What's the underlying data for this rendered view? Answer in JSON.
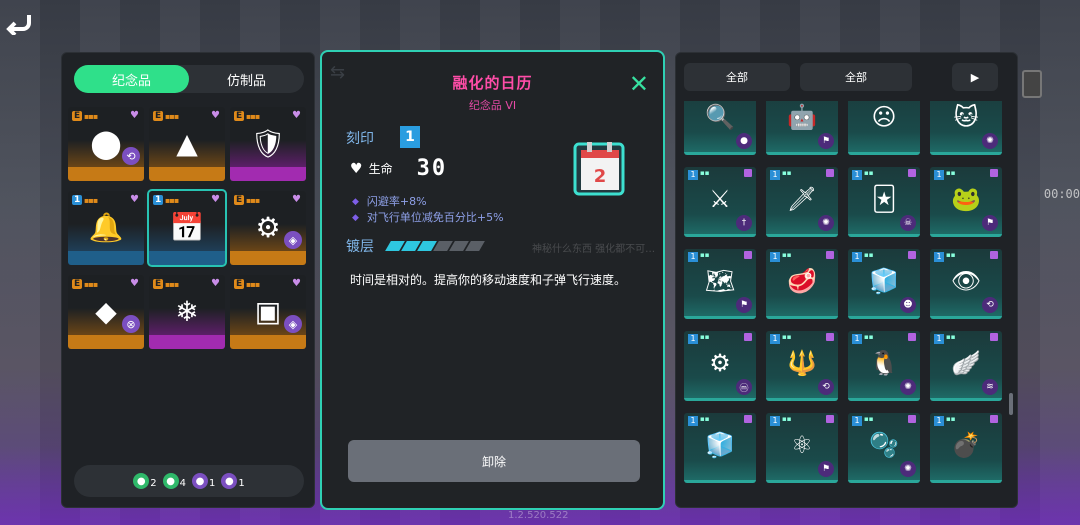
{
  "left_panel": {
    "tabs": [
      {
        "label": "纪念品",
        "active": true
      },
      {
        "label": "仿制品",
        "active": false
      }
    ],
    "items": [
      {
        "rank": "E",
        "rarity": "orange",
        "icon": "orb-cluster-icon",
        "glyph": "⬤",
        "corner": "⟲",
        "corner_color": "#7b4fc0"
      },
      {
        "rank": "E",
        "rarity": "orange",
        "icon": "triangle-icon",
        "glyph": "▲",
        "corner": "",
        "corner_color": ""
      },
      {
        "rank": "E",
        "rarity": "purple",
        "icon": "shield-icon",
        "glyph": "🛡",
        "corner": "",
        "corner_color": ""
      },
      {
        "rank": "1",
        "rarity": "blue",
        "icon": "bell-icon",
        "glyph": "🔔",
        "corner": "",
        "corner_color": ""
      },
      {
        "rank": "1",
        "rarity": "selected",
        "icon": "calendar-icon",
        "glyph": "📅",
        "corner": "",
        "corner_color": ""
      },
      {
        "rank": "E",
        "rarity": "orange",
        "icon": "gun-icon",
        "glyph": "⚙",
        "corner": "◈",
        "corner_color": "#7b4fc0"
      },
      {
        "rank": "E",
        "rarity": "orange",
        "icon": "crystal-icon",
        "glyph": "◆",
        "corner": "⊗",
        "corner_color": "#7b4fc0"
      },
      {
        "rank": "E",
        "rarity": "purple",
        "icon": "ice-icon",
        "glyph": "❄",
        "corner": "",
        "corner_color": ""
      },
      {
        "rank": "E",
        "rarity": "orange",
        "icon": "chip-icon",
        "glyph": "▣",
        "corner": "◈",
        "corner_color": "#7b4fc0"
      }
    ],
    "stats": [
      {
        "icon": "green-face-icon",
        "color": "#2fb86a",
        "count": "2"
      },
      {
        "icon": "green-up-icon",
        "color": "#2fb86a",
        "count": "4"
      },
      {
        "icon": "purple-cross-icon",
        "color": "#7b4fc0",
        "count": "1"
      },
      {
        "icon": "purple-eye-icon",
        "color": "#7b4fc0",
        "count": "1"
      }
    ]
  },
  "detail": {
    "title": "融化的日历",
    "subtitle": "纪念品 VI",
    "engrave_label": "刻印",
    "engrave_value": "1",
    "life_label": "生命",
    "life_value": "30",
    "buffs": [
      "闪避率+8%",
      "对飞行单位减免百分比+5%"
    ],
    "plating_label": "镀层",
    "plating_on": 3,
    "plating_total": 6,
    "faded_text": "神秘什么东西 强化都不可…",
    "description": "时间是相对的。提高你的移动速度和子弹飞行速度。",
    "unload_label": "卸除"
  },
  "right_panel": {
    "filters": [
      "全部",
      "全部",
      "▶"
    ],
    "rows": [
      [
        {
          "icon": "magnifier-icon",
          "glyph": "🔍",
          "corner": "●"
        },
        {
          "icon": "robot-icon",
          "glyph": "🤖",
          "corner": "⚑"
        },
        {
          "icon": "sad-face-icon",
          "glyph": "☹",
          "corner": ""
        },
        {
          "icon": "cat-mask-icon",
          "glyph": "🐱",
          "corner": "✺"
        }
      ],
      [
        {
          "icon": "sword-icon",
          "glyph": "⚔",
          "corner": "†"
        },
        {
          "icon": "blade-icon",
          "glyph": "🗡",
          "corner": "✺"
        },
        {
          "icon": "card-icon",
          "glyph": "🃏",
          "corner": "☠"
        },
        {
          "icon": "green-creature-icon",
          "glyph": "🐸",
          "corner": "⚑"
        }
      ],
      [
        {
          "icon": "map-icon",
          "glyph": "🗺",
          "corner": "⚑"
        },
        {
          "icon": "steak-icon",
          "glyph": "🥩",
          "corner": ""
        },
        {
          "icon": "fridge-icon",
          "glyph": "🧊",
          "corner": "☻"
        },
        {
          "icon": "blue-eye-icon",
          "glyph": "👁",
          "corner": "⟲"
        }
      ],
      [
        {
          "icon": "gear-icon",
          "glyph": "⚙",
          "corner": "ⓜ"
        },
        {
          "icon": "trident-icon",
          "glyph": "🔱",
          "corner": "⟲"
        },
        {
          "icon": "penguin-icon",
          "glyph": "🐧",
          "corner": "✺"
        },
        {
          "icon": "wing-icon",
          "glyph": "🪽",
          "corner": "≋"
        }
      ],
      [
        {
          "icon": "cube-icon",
          "glyph": "🧊",
          "corner": ""
        },
        {
          "icon": "atom-icon",
          "glyph": "⚛",
          "corner": "⚑"
        },
        {
          "icon": "slime-icon",
          "glyph": "🫧",
          "corner": "✺"
        },
        {
          "icon": "bomb-icon",
          "glyph": "💣",
          "corner": ""
        }
      ]
    ]
  },
  "misc": {
    "timer": "00:00",
    "version": "1.2.520.522"
  }
}
